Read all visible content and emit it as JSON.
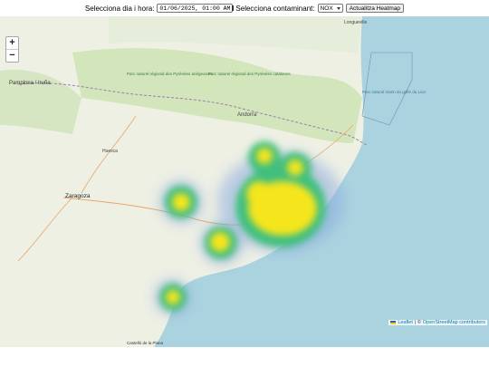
{
  "controls": {
    "date_label": "Selecciona dia i hora:",
    "date_value": "01/06/2025, 01:00 AM",
    "pollutant_label": "Selecciona contaminant:",
    "pollutant_value": "NOX",
    "update_button": "Actualitza Heatmap"
  },
  "zoom": {
    "in": "+",
    "out": "−"
  },
  "attribution": {
    "leaflet": "Leaflet",
    "separator": "| ©",
    "osm": "OpenStreetMap contributors"
  },
  "map_labels": {
    "pamplona": "Pamplona / Iruña",
    "zaragoza": "Zaragoza",
    "huesca": "Huesca",
    "andorra": "Andorra",
    "longueville": "Longueville",
    "park1": "Parc naturel régional des Pyrénées catalanes",
    "park2": "Parc naturel régional des Pyrénées ariégeoises",
    "park3": "Parc naturel marin du golfe du Lion",
    "castello": "Castelló de la Plana"
  },
  "heatmap": {
    "pollutant": "NOX",
    "colors": {
      "low": "#5b8fd6",
      "mid": "#3fbf7f",
      "high": "#f5e51b"
    }
  }
}
